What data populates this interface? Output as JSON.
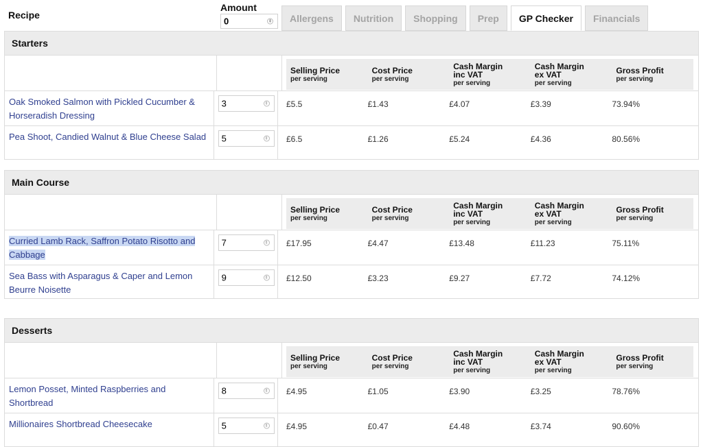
{
  "header": {
    "recipe_label": "Recipe",
    "amount_label": "Amount",
    "amount_value": "0"
  },
  "tabs": [
    {
      "label": "Allergens",
      "active": false
    },
    {
      "label": "Nutrition",
      "active": false
    },
    {
      "label": "Shopping",
      "active": false
    },
    {
      "label": "Prep",
      "active": false
    },
    {
      "label": "GP Checker",
      "active": true
    },
    {
      "label": "Financials",
      "active": false
    }
  ],
  "column_headers": {
    "selling_price": {
      "title": "Selling Price",
      "sub": "per serving"
    },
    "cost_price": {
      "title": "Cost Price",
      "sub": "per serving"
    },
    "cash_margin_inc": {
      "title": "Cash Margin",
      "title2": "inc VAT",
      "sub": "per serving"
    },
    "cash_margin_ex": {
      "title": "Cash Margin",
      "title2": "ex VAT",
      "sub": "per serving"
    },
    "gross_profit": {
      "title": "Gross Profit",
      "sub": "per serving"
    }
  },
  "sections": [
    {
      "title": "Starters",
      "rows": [
        {
          "name": "Oak Smoked Salmon with Pickled Cucumber & Horseradish Dressing",
          "amount": "3",
          "selling": "£5.5",
          "cost": "£1.43",
          "margin_inc": "£4.07",
          "margin_ex": "£3.39",
          "gp": "73.94%"
        },
        {
          "name": "Pea Shoot, Candied Walnut & Blue Cheese Salad",
          "amount": "5",
          "selling": "£6.5",
          "cost": "£1.26",
          "margin_inc": "£5.24",
          "margin_ex": "£4.36",
          "gp": "80.56%"
        }
      ]
    },
    {
      "title": "Main Course",
      "rows": [
        {
          "name": "Curried Lamb Rack, Saffron Potato Risotto and Cabbage",
          "amount": "7",
          "selling": "£17.95",
          "cost": "£4.47",
          "margin_inc": "£13.48",
          "margin_ex": "£11.23",
          "gp": "75.11%"
        },
        {
          "name": "Sea Bass with Asparagus & Caper and Lemon Beurre Noisette",
          "amount": "9",
          "selling": "£12.50",
          "cost": "£3.23",
          "margin_inc": "£9.27",
          "margin_ex": "£7.72",
          "gp": "74.12%"
        }
      ]
    },
    {
      "title": "Desserts",
      "rows": [
        {
          "name": "Lemon Posset, Minted Raspberries and Shortbread",
          "amount": "8",
          "selling": "£4.95",
          "cost": "£1.05",
          "margin_inc": "£3.90",
          "margin_ex": "£3.25",
          "gp": "78.76%"
        },
        {
          "name": "Millionaires Shortbread Cheesecake",
          "amount": "5",
          "selling": "£4.95",
          "cost": "£0.47",
          "margin_inc": "£4.48",
          "margin_ex": "£3.74",
          "gp": "90.60%"
        }
      ]
    }
  ],
  "colors": {
    "link": "#2f3f8f",
    "header_bg": "#ececec",
    "inactive_tab_text": "#a4a4a4",
    "selection": "#c9d8f3"
  }
}
